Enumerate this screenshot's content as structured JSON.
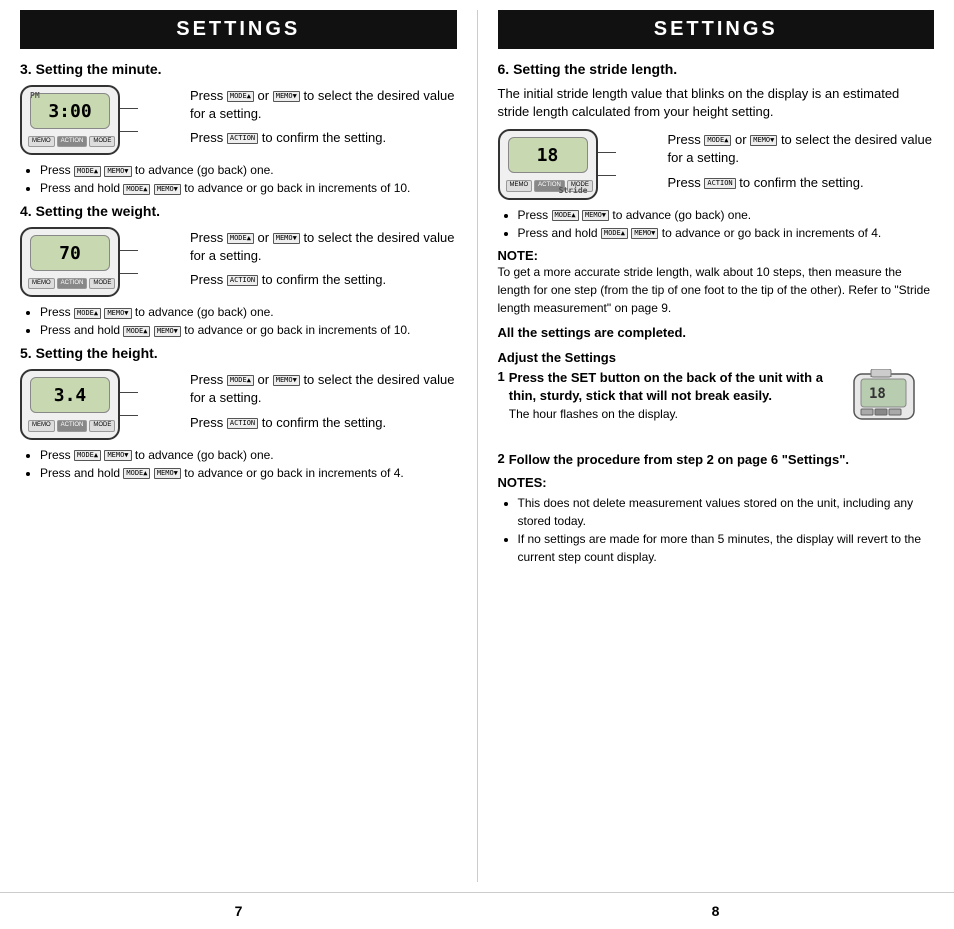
{
  "left_header": "SETTINGS",
  "right_header": "SETTINGS",
  "section3": {
    "title": "3. Setting the minute.",
    "screen_value": "3:00",
    "buttons": [
      "MEMO",
      "ACTION",
      "MODE"
    ],
    "instruction1": "Press",
    "instruction1_icon1": "MODE▲",
    "instruction1_mid": "or",
    "instruction1_icon2": "MEMO▼",
    "instruction1_end": "to select the desired value for a setting.",
    "instruction2": "Press",
    "instruction2_icon": "ACTION",
    "instruction2_end": "to confirm the setting.",
    "bullet1": "Press",
    "bullet1_icon1": "MODE▲",
    "bullet1_paren": "(MEMO▼)",
    "bullet1_end": "to advance (go back) one.",
    "bullet2": "Press and hold",
    "bullet2_icon1": "MODE▲",
    "bullet2_paren": "(MEMO▼)",
    "bullet2_end": "to advance or go back in increments of 10."
  },
  "section4": {
    "title": "4. Setting the weight.",
    "screen_value": "70",
    "buttons": [
      "MEMO",
      "ACTION",
      "MODE"
    ],
    "instruction1": "Press",
    "instruction1_icon1": "MODE▲",
    "instruction1_mid": "or",
    "instruction1_icon2": "MEMO▼",
    "instruction1_end": "to select the desired value for a setting.",
    "instruction2": "Press",
    "instruction2_icon": "ACTION",
    "instruction2_end": "to confirm the setting.",
    "bullet1": "Press",
    "bullet1_icon1": "MODE▲",
    "bullet1_paren": "(MEMO▼)",
    "bullet1_end": "to advance (go back) one.",
    "bullet2": "Press and hold",
    "bullet2_icon1": "MODE▲",
    "bullet2_paren": "(MEMO▼)",
    "bullet2_end": "to advance or go back in increments of 10."
  },
  "section5": {
    "title": "5. Setting the height.",
    "screen_value": "3.4",
    "buttons": [
      "MEMO",
      "ACTION",
      "MODE"
    ],
    "instruction1": "Press",
    "instruction1_icon1": "MODE▲",
    "instruction1_mid": "or",
    "instruction1_icon2": "MEMO▼",
    "instruction1_end": "to select the desired value for a setting.",
    "instruction2": "Press",
    "instruction2_icon": "ACTION",
    "instruction2_end": "to confirm the setting.",
    "bullet1": "Press",
    "bullet1_icon1": "MODE▲",
    "bullet1_paren": "(MEMO▼)",
    "bullet1_end": "to advance (go back) one.",
    "bullet2": "Press and hold",
    "bullet2_icon1": "MODE▲",
    "bullet2_paren": "(MEMO▼)",
    "bullet2_end": "to advance or go back in increments of 4."
  },
  "section6": {
    "title": "6. Setting the stride length.",
    "intro": "The initial stride length value that blinks on the display is an estimated stride length calculated from your height setting.",
    "screen_value": "18",
    "buttons": [
      "MEMO",
      "ACTION",
      "MODE"
    ],
    "instruction1": "Press",
    "instruction1_icon1": "MODE▲",
    "instruction1_mid": "or",
    "instruction1_icon2": "MEMO▼",
    "instruction1_end": "to select the desired value for a setting.",
    "instruction2": "Press",
    "instruction2_icon": "ACTION",
    "instruction2_end": "to confirm the setting.",
    "bullet1": "Press",
    "bullet1_icon1": "MODE▲",
    "bullet1_paren": "(MEMO▼)",
    "bullet1_end": "to advance (go back) one.",
    "bullet2": "Press and hold",
    "bullet2_icon1": "MODE▲",
    "bullet2_paren": "(MEMO▼)",
    "bullet2_end": "to advance or go back in increments of 4.",
    "note_label": "NOTE:",
    "note_text": "To get a more accurate stride length, walk about 10 steps, then measure the length for one step (from the tip of one foot to the tip of the other). Refer to \"Stride length measurement\" on page 9."
  },
  "all_complete": "All the settings are completed.",
  "adjust_header": "Adjust the Settings",
  "adjust_item1_num": "1",
  "adjust_item1_text": "Press the SET button on the back of the unit with a thin, sturdy, stick that will not break easily.",
  "adjust_item1_sub": "The hour flashes on the display.",
  "adjust_item2_num": "2",
  "adjust_item2_text": "Follow the procedure from step 2 on page 6 \"Settings\".",
  "notes_header": "NOTES:",
  "note1": "This does not delete measurement values stored on the unit, including any stored today.",
  "note2": "If no settings are made for more than 5 minutes, the display will revert to the current step count display.",
  "page_left": "7",
  "page_right": "8"
}
